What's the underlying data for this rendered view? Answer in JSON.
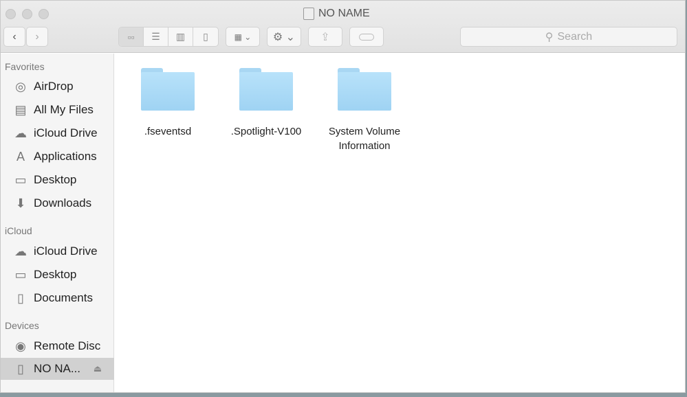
{
  "window": {
    "title": "NO NAME"
  },
  "toolbar": {
    "back": "‹",
    "forward": "›",
    "search_placeholder": "Search"
  },
  "sidebar": {
    "sections": [
      {
        "label": "Favorites",
        "items": [
          {
            "label": "AirDrop",
            "icon": "airdrop-icon"
          },
          {
            "label": "All My Files",
            "icon": "all-files-icon"
          },
          {
            "label": "iCloud Drive",
            "icon": "cloud-icon"
          },
          {
            "label": "Applications",
            "icon": "applications-icon"
          },
          {
            "label": "Desktop",
            "icon": "desktop-icon"
          },
          {
            "label": "Downloads",
            "icon": "downloads-icon"
          }
        ]
      },
      {
        "label": "iCloud",
        "items": [
          {
            "label": "iCloud Drive",
            "icon": "cloud-icon"
          },
          {
            "label": "Desktop",
            "icon": "desktop-icon"
          },
          {
            "label": "Documents",
            "icon": "documents-icon"
          }
        ]
      },
      {
        "label": "Devices",
        "items": [
          {
            "label": "Remote Disc",
            "icon": "disc-icon"
          },
          {
            "label": "NO NA...",
            "icon": "drive-icon",
            "selected": true
          }
        ]
      }
    ]
  },
  "files": [
    {
      "name": ".fseventsd"
    },
    {
      "name": ".Spotlight-V100"
    },
    {
      "name": "System Volume Information"
    }
  ]
}
